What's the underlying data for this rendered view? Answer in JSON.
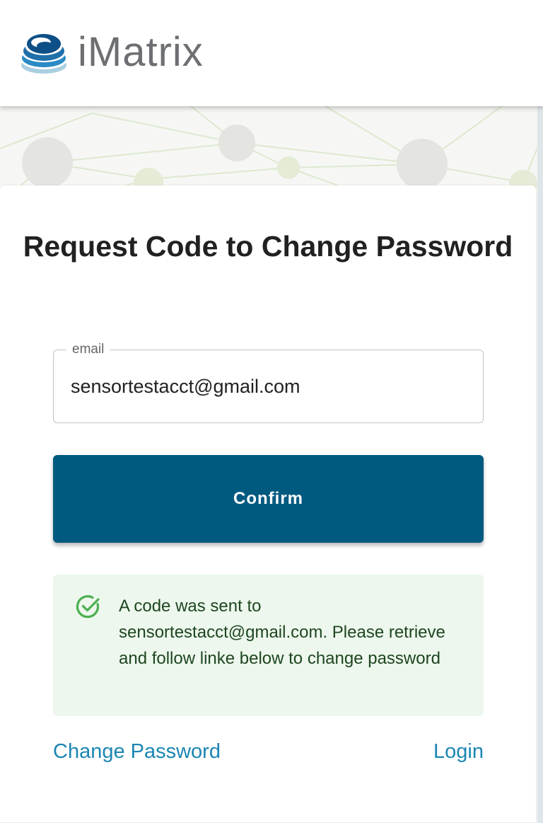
{
  "header": {
    "logo_text": "iMatrix",
    "logo_icon": "imatrix-swirl-logo"
  },
  "form": {
    "title": "Request Code to Change Password",
    "email_label": "email",
    "email_value": "sensortestacct@gmail.com",
    "confirm_label": "Confirm"
  },
  "alert": {
    "icon": "check-circle-icon",
    "message": "A code was sent to sensortestacct@gmail.com. Please retrieve and follow linke below to change password"
  },
  "links": {
    "change_password": "Change Password",
    "login": "Login"
  },
  "colors": {
    "primary": "#005a80",
    "link": "#1b86b3",
    "success_bg": "#edf7ed",
    "success_text": "#1e4620",
    "success_icon": "#4caf50",
    "logo_text": "#6d6f72"
  }
}
